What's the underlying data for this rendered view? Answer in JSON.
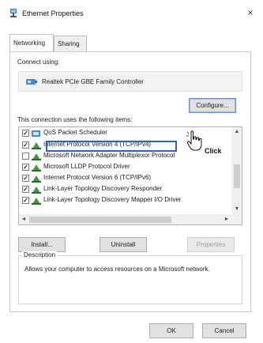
{
  "window": {
    "title": "Ethernet Properties",
    "close_glyph": "×",
    "icon": "network-adapter-icon"
  },
  "tabs": [
    {
      "label": "Networking",
      "active": true
    },
    {
      "label": "Sharing",
      "active": false
    }
  ],
  "connect_using": {
    "label": "Connect using:",
    "adapter": "Realtek PCIe GBE Family Controller",
    "adapter_icon": "network-card-icon"
  },
  "buttons": {
    "configure": "Configure...",
    "install": "Install...",
    "uninstall": "Uninstall",
    "properties": "Properties",
    "ok": "OK",
    "cancel": "Cancel"
  },
  "items_label": "This connection uses the following items:",
  "items": [
    {
      "label": "QoS Packet Scheduler",
      "checked": true,
      "check_glyph": "✓",
      "icon": "scheduler-icon"
    },
    {
      "label": "Internet Protocol Version 4 (TCP/IPv4)",
      "checked": true,
      "check_glyph": "✓",
      "icon": "protocol-icon",
      "highlighted": true
    },
    {
      "label": "Microsoft Network Adapter Multiplexor Protocol",
      "checked": false,
      "check_glyph": "",
      "icon": "protocol-icon"
    },
    {
      "label": "Microsoft LLDP Protocol Driver",
      "checked": true,
      "check_glyph": "✓",
      "icon": "protocol-icon"
    },
    {
      "label": "Internet Protocol Version 6 (TCP/IPv6)",
      "checked": true,
      "check_glyph": "✓",
      "icon": "protocol-icon"
    },
    {
      "label": "Link-Layer Topology Discovery Responder",
      "checked": true,
      "check_glyph": "✓",
      "icon": "protocol-icon"
    },
    {
      "label": "Link-Layer Topology Discovery Mapper I/O Driver",
      "checked": true,
      "check_glyph": "✓",
      "icon": "protocol-icon"
    }
  ],
  "scroll": {
    "up": "▲",
    "down": "▼",
    "left": "◄",
    "right": "►"
  },
  "description": {
    "legend": "Description",
    "text": "Allows your computer to access resources on a Microsoft network."
  },
  "annotation": {
    "click_label": "Click"
  },
  "colors": {
    "highlight_border": "#2f63b3",
    "protocol_icon_green": "#3f9a3f"
  }
}
